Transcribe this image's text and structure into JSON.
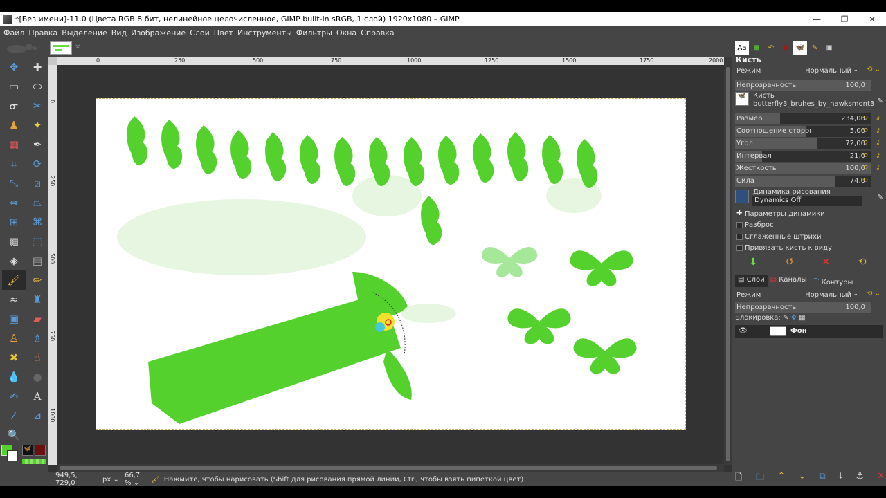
{
  "window": {
    "title": "*[Без имени]-11.0 (Цвета RGB 8 бит, нелинейное целочисленное, GIMP built-in sRGB, 1 слой) 1920x1080 – GIMP",
    "minimize": "—",
    "maximize": "❐",
    "close": "✕"
  },
  "menu": [
    "Файл",
    "Правка",
    "Выделение",
    "Вид",
    "Изображение",
    "Слой",
    "Цвет",
    "Инструменты",
    "Фильтры",
    "Окна",
    "Справка"
  ],
  "canvas": {
    "ruler_top": [
      "0",
      "250",
      "500",
      "750",
      "1000",
      "1250",
      "1500",
      "1750",
      "2000"
    ],
    "ruler_left": [
      "0",
      "250",
      "500",
      "750",
      "1000"
    ]
  },
  "status": {
    "coords": "949,5, 729,0",
    "unit": "px",
    "zoom": "66,7 %",
    "hint": "Нажмите, чтобы нарисовать (Shift для рисования прямой линии, Ctrl, чтобы взять пипеткой цвет)"
  },
  "tool_options": {
    "title": "Кисть",
    "mode_label": "Режим",
    "mode_value": "Нормальный",
    "opacity_label": "Непрозрачность",
    "opacity_value": "100,0",
    "brush_label": "Кисть",
    "brush_name": "butterfly3_bruhes_by_hawksmont3",
    "size_label": "Размер",
    "size_value": "234,00",
    "aspect_label": "Соотношение сторон",
    "aspect_value": "5,00",
    "angle_label": "Угол",
    "angle_value": "72,00",
    "spacing_label": "Интервал",
    "spacing_value": "21,0",
    "hardness_label": "Жесткость",
    "hardness_value": "100,0",
    "force_label": "Сила",
    "force_value": "74,0",
    "dynamics_label": "Динамика рисования",
    "dynamics_value": "Dynamics Off",
    "dynamics_options": "Параметры динамики",
    "jitter": "Разброс",
    "smooth": "Сглаженные штрихи",
    "lock_to_view": "Привязать кисть к виду"
  },
  "slider_levels": {
    "opacity": 1.0,
    "size": 0.33,
    "aspect": 0.52,
    "angle": 0.6,
    "spacing": 0.2,
    "hardness": 1.0,
    "force": 0.74
  },
  "layers": {
    "tabs": [
      "Слои",
      "Каналы",
      "Контуры"
    ],
    "mode_label": "Режим",
    "mode_value": "Нормальный",
    "opacity_label": "Непрозрачность",
    "opacity_value": "100,0",
    "lock_label": "Блокировка:",
    "layer_name": "Фон"
  },
  "colors": {
    "foreground": "#55d12e",
    "background": "#ffffff",
    "ui_bg": "#454545",
    "canvas_bg": "#333333"
  }
}
